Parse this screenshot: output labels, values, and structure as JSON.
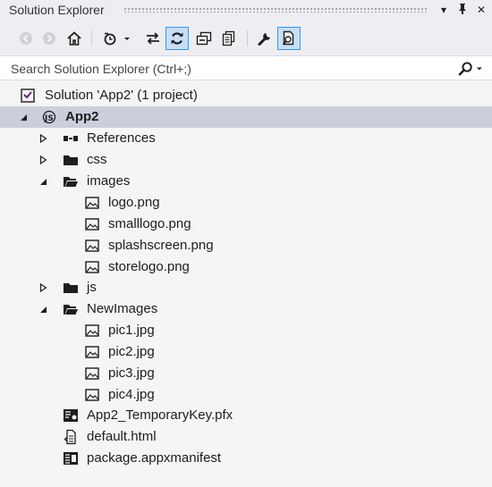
{
  "window": {
    "title": "Solution Explorer"
  },
  "toolbar": {
    "buttons": [
      "back-icon",
      "forward-icon",
      "home-icon",
      "pending-changes-filter-icon",
      "sync-with-active-document-icon",
      "refresh-icon",
      "collapse-all-icon",
      "show-all-files-icon",
      "properties-icon",
      "preview-selected-items-icon"
    ]
  },
  "search": {
    "placeholder": "Search Solution Explorer (Ctrl+;)"
  },
  "tree": {
    "solution": "Solution 'App2' (1 project)",
    "project": "App2",
    "references": "References",
    "css": "css",
    "images": "images",
    "images_files": [
      "logo.png",
      "smalllogo.png",
      "splashscreen.png",
      "storelogo.png"
    ],
    "js": "js",
    "newimages": "NewImages",
    "newimages_files": [
      "pic1.jpg",
      "pic2.jpg",
      "pic3.jpg",
      "pic4.jpg"
    ],
    "pfx": "App2_TemporaryKey.pfx",
    "default_html": "default.html",
    "manifest": "package.appxmanifest"
  },
  "colors": {
    "selection": "#cccedb",
    "active_button_border": "#3399ff",
    "folder": "#1e1e1e"
  }
}
